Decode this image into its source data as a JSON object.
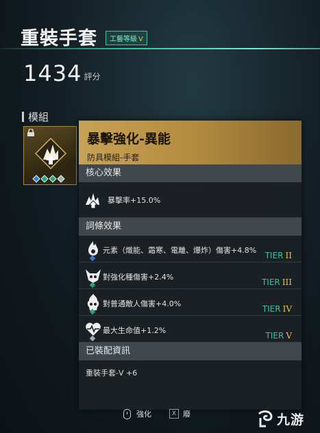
{
  "header": {
    "title": "重裝手套",
    "grade_label": "工藝等級",
    "grade_roman": "V"
  },
  "score": {
    "value": "1434",
    "unit": "評分"
  },
  "modules": {
    "label": "模組"
  },
  "panel": {
    "name": "暴擊強化-異能",
    "subtitle": "防具模組-手套",
    "core_section": "核心效果",
    "core_effect": "暴擊率+15.0%",
    "affix_section": "詞條效果",
    "affixes": [
      {
        "text": "元素（熾能、霜寒、電離、爆炸）傷害+4.8%",
        "tier_label": "TIER",
        "tier_roman": "II",
        "marker": "blue"
      },
      {
        "text": "對強化種傷害+2.4%",
        "tier_label": "TIER",
        "tier_roman": "III",
        "marker": "green"
      },
      {
        "text": "對普通敵人傷害+4.0%",
        "tier_label": "TIER",
        "tier_roman": "IV",
        "marker": "green"
      },
      {
        "text": "最大生命值+1.2%",
        "tier_label": "TIER",
        "tier_roman": "V",
        "marker": "gray"
      }
    ],
    "equip_section": "已裝配資訊",
    "equip_item": "重裝手套-V +6"
  },
  "controls": {
    "enhance_label": "強化",
    "x_key": "X",
    "x_label": "廢"
  },
  "watermark": {
    "text": "九游"
  },
  "colors": {
    "accent_green": "#3fbf9a",
    "gold": "#c8a256",
    "roman_gold": "#e6c24a",
    "marker_blue": "#3b7bd6",
    "marker_green": "#2aa37c",
    "marker_gray": "#aaaaaa"
  },
  "icons": {
    "lock": "lock-icon",
    "module_emblem": "crit-module-emblem-icon",
    "core": "crit-burst-icon",
    "affix_icons": [
      "elemental-flame-icon",
      "horned-beast-icon",
      "flame-skull-icon",
      "heart-pulse-icon"
    ],
    "mouse": "mouse-icon",
    "watermark_logo": "swirl-logo-icon"
  }
}
